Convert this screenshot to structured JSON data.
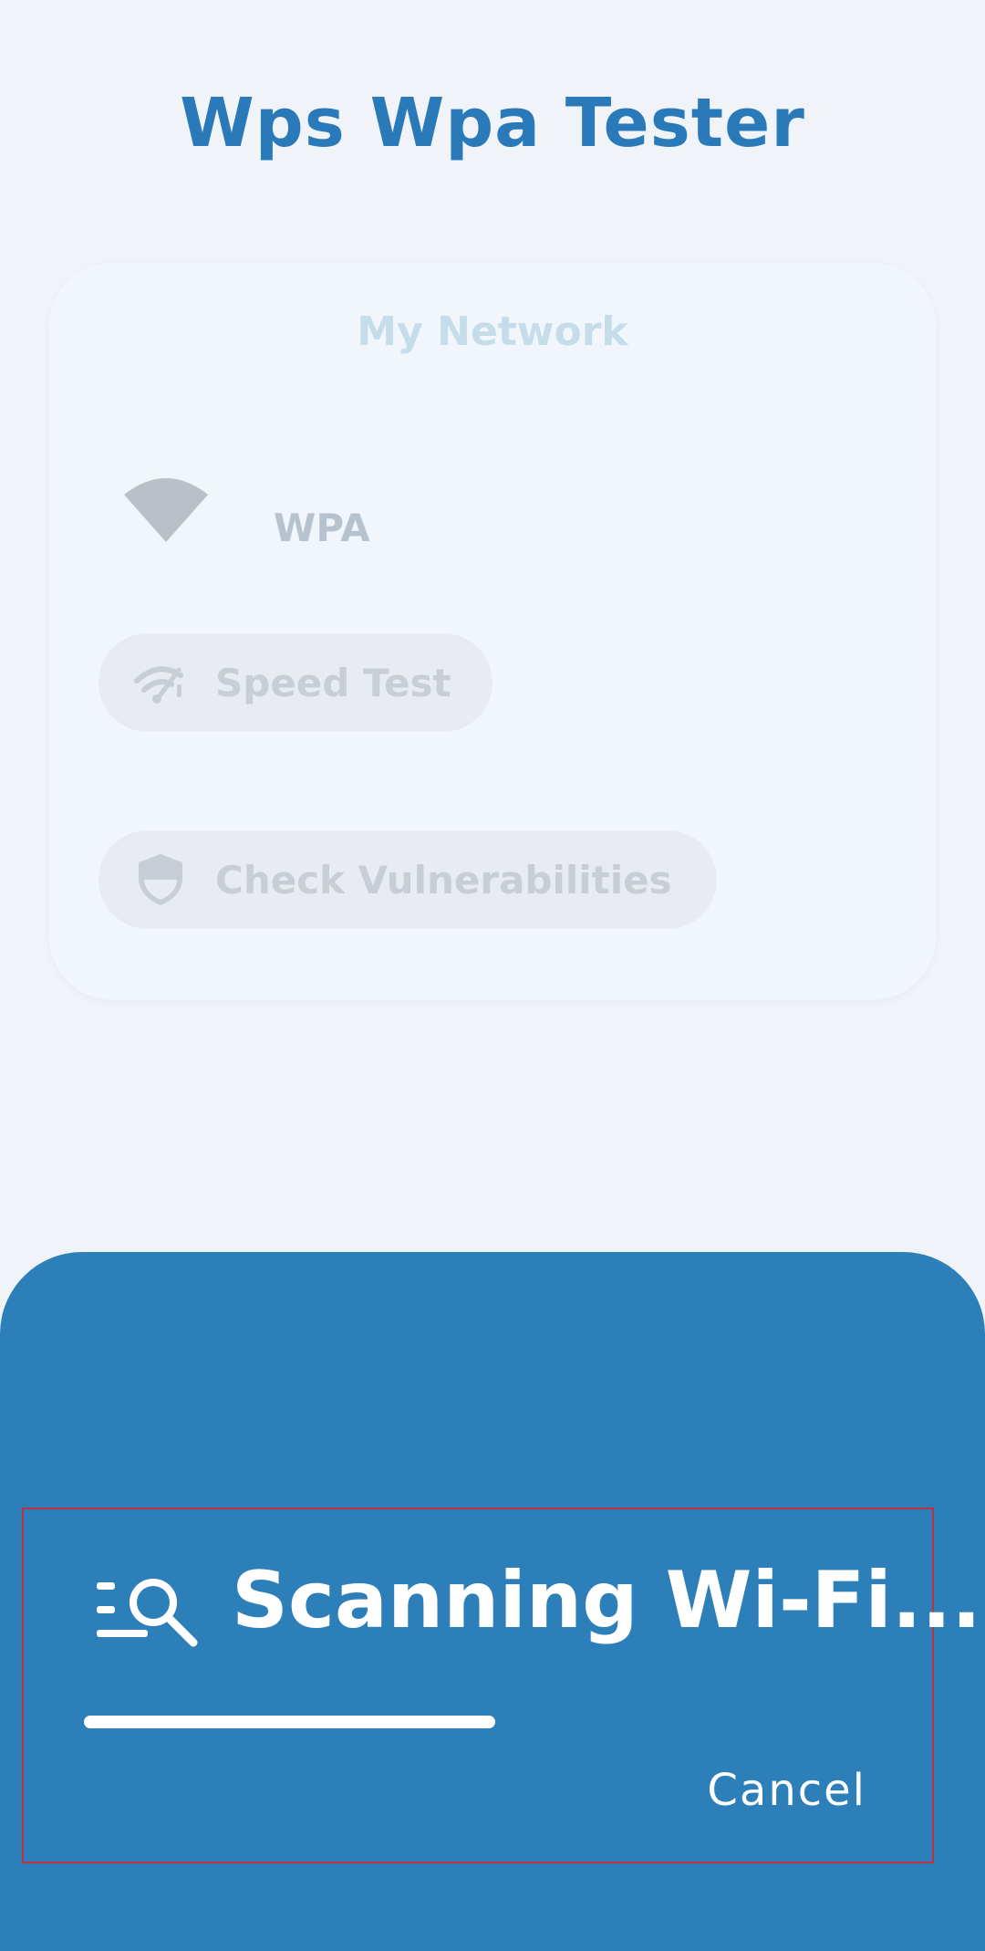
{
  "app": {
    "title": "Wps Wpa Tester"
  },
  "network_card": {
    "title": "My Network",
    "security_type": "WPA",
    "icon": "wifi-icon",
    "actions": [
      {
        "label": "Speed Test",
        "icon": "speedometer-wifi-icon"
      },
      {
        "label": "Check Vulnerabilities",
        "icon": "shield-icon"
      }
    ]
  },
  "scan_dialog": {
    "status": "Scanning Wi-Fi...",
    "icon": "search-list-icon",
    "progress_fraction": 0.53,
    "cancel_label": "Cancel"
  },
  "colors": {
    "accent": "#2a79b8",
    "sheet": "#2c7fb8",
    "background": "#f0f3f8",
    "highlight": "#c0313e"
  }
}
